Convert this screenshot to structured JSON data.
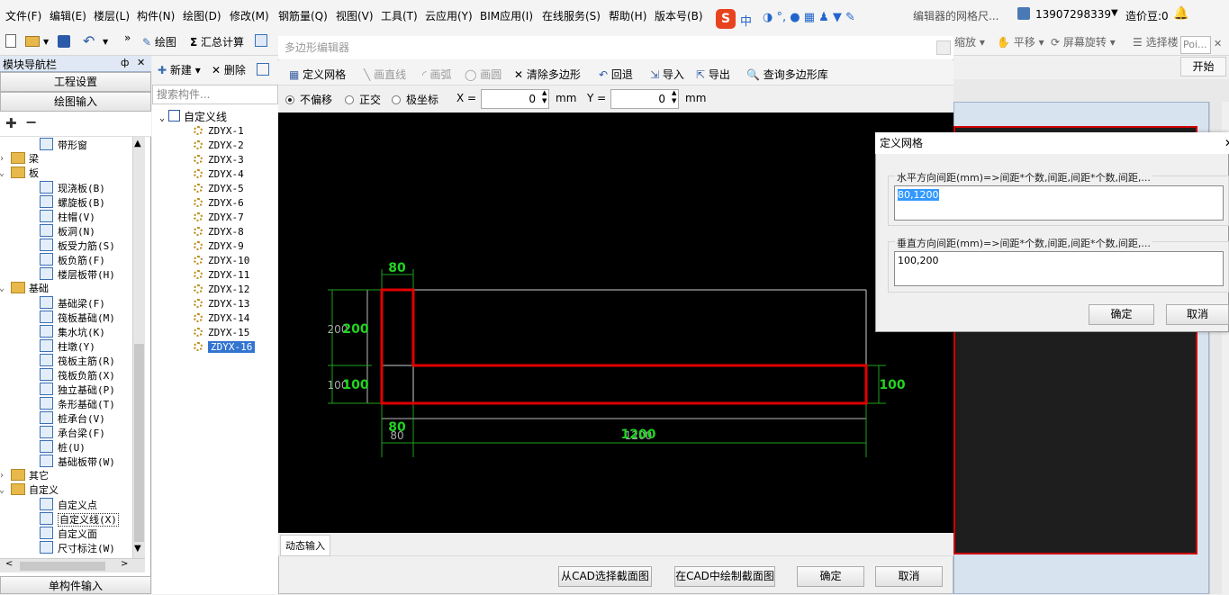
{
  "menu": [
    "文件(F)",
    "编辑(E)",
    "楼层(L)",
    "构件(N)",
    "绘图(D)",
    "修改(M)",
    "钢筋量(Q)",
    "视图(V)",
    "工具(T)",
    "云应用(Y)",
    "BIM应用(I)",
    "在线服务(S)",
    "帮助(H)",
    "版本号(B)"
  ],
  "topbar": {
    "ime_label": "中",
    "notice": "编辑器的网格尺...",
    "account": "13907298339",
    "credits": "造价豆:0"
  },
  "toolbar": {
    "draw": "绘图",
    "sum": "汇总计算",
    "zoom": "缩放",
    "pan": "平移",
    "rotate": "屏幕旋转",
    "select": "选择楼",
    "poi": "Poi...",
    "start": "开始"
  },
  "nav": {
    "title": "模块导航栏",
    "pin": "ф",
    "close": "✕",
    "btn_project": "工程设置",
    "btn_draw": "绘图输入",
    "bottom": "单构件输入",
    "items": [
      {
        "label": "带形窗",
        "indent": 2
      },
      {
        "label": "梁",
        "indent": 0,
        "folder": true,
        "state": ">"
      },
      {
        "label": "板",
        "indent": 0,
        "folder": true,
        "state": "v"
      },
      {
        "label": "现浇板(B)",
        "indent": 1
      },
      {
        "label": "螺旋板(B)",
        "indent": 1
      },
      {
        "label": "柱帽(V)",
        "indent": 1
      },
      {
        "label": "板洞(N)",
        "indent": 1
      },
      {
        "label": "板受力筋(S)",
        "indent": 1
      },
      {
        "label": "板负筋(F)",
        "indent": 1
      },
      {
        "label": "楼层板带(H)",
        "indent": 1
      },
      {
        "label": "基础",
        "indent": 0,
        "folder": true,
        "state": "v"
      },
      {
        "label": "基础梁(F)",
        "indent": 1
      },
      {
        "label": "筏板基础(M)",
        "indent": 1
      },
      {
        "label": "集水坑(K)",
        "indent": 1
      },
      {
        "label": "柱墩(Y)",
        "indent": 1
      },
      {
        "label": "筏板主筋(R)",
        "indent": 1
      },
      {
        "label": "筏板负筋(X)",
        "indent": 1
      },
      {
        "label": "独立基础(P)",
        "indent": 1
      },
      {
        "label": "条形基础(T)",
        "indent": 1
      },
      {
        "label": "桩承台(V)",
        "indent": 1
      },
      {
        "label": "承台梁(F)",
        "indent": 1
      },
      {
        "label": "桩(U)",
        "indent": 1
      },
      {
        "label": "基础板带(W)",
        "indent": 1
      },
      {
        "label": "其它",
        "indent": 0,
        "folder": true,
        "state": ">"
      },
      {
        "label": "自定义",
        "indent": 0,
        "folder": true,
        "state": "v"
      },
      {
        "label": "自定义点",
        "indent": 1
      },
      {
        "label": "自定义线(X)",
        "indent": 1,
        "selected": true
      },
      {
        "label": "自定义面",
        "indent": 1
      },
      {
        "label": "尺寸标注(W)",
        "indent": 1
      }
    ]
  },
  "components": {
    "new": "新建",
    "delete": "删除",
    "search_placeholder": "搜索构件...",
    "root": "自定义线",
    "items": [
      "ZDYX-1",
      "ZDYX-2",
      "ZDYX-3",
      "ZDYX-4",
      "ZDYX-5",
      "ZDYX-6",
      "ZDYX-7",
      "ZDYX-8",
      "ZDYX-9",
      "ZDYX-10",
      "ZDYX-11",
      "ZDYX-12",
      "ZDYX-13",
      "ZDYX-14",
      "ZDYX-15",
      "ZDYX-16"
    ],
    "selected": "ZDYX-16"
  },
  "poly_editor": {
    "title": "多边形编辑器",
    "tools": {
      "define_grid": "定义网格",
      "line": "画直线",
      "arc": "画弧",
      "circle": "画圆",
      "clear": "清除多边形",
      "undo": "回退",
      "import": "导入",
      "export": "导出",
      "query": "查询多边形库"
    },
    "modes": {
      "no_offset": "不偏移",
      "ortho": "正交",
      "polar": "极坐标"
    },
    "x_label": "X =",
    "x_value": "0",
    "y_label": "Y =",
    "y_value": "0",
    "unit": "mm",
    "dims": {
      "top": "80",
      "left_upper_grey": "200",
      "left_upper_green": "200",
      "left_lower_grey": "100",
      "left_lower_green": "100",
      "right": "100",
      "bottom_left_green": "80",
      "bottom_left_grey": "80",
      "bottom_main_green": "1200",
      "bottom_main_grey": "1200"
    },
    "dynamic_input": "动态输入",
    "btn_cad_select": "从CAD选择截面图",
    "btn_cad_draw": "在CAD中绘制截面图",
    "btn_ok": "确定",
    "btn_cancel": "取消"
  },
  "grid_dialog": {
    "title": "定义网格",
    "close": "✕",
    "h_label": "水平方向间距(mm)=>间距*个数,间距,间距*个数,间距,...",
    "h_value": "80,1200",
    "v_label": "垂直方向间距(mm)=>间距*个数,间距,间距*个数,间距,...",
    "v_value": "100,200",
    "ok": "确定",
    "cancel": "取消"
  }
}
